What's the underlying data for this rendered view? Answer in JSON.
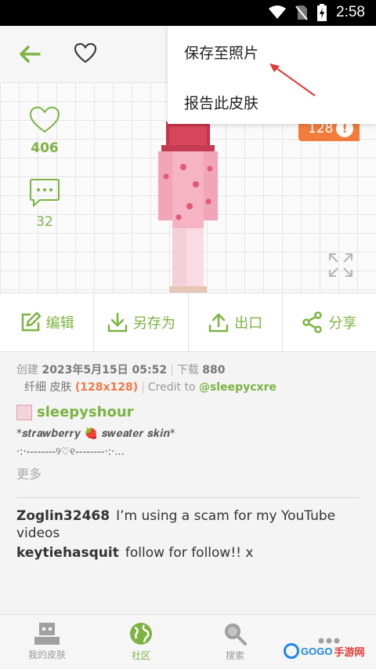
{
  "status_bar": {
    "time": "2:58",
    "icons": [
      "wifi-icon",
      "no-sim-icon",
      "battery-charging-icon"
    ]
  },
  "toolbar": {
    "back": "arrow-left-icon",
    "favorite": "heart-outline-icon"
  },
  "menu": {
    "items": [
      "保存至照片",
      "报告此皮肤"
    ]
  },
  "preview": {
    "likes": "406",
    "comments": "32",
    "resolution_badge": "128",
    "info_symbol": "!"
  },
  "actions": [
    {
      "label": "编辑",
      "icon": "edit-icon"
    },
    {
      "label": "另存为",
      "icon": "download-icon"
    },
    {
      "label": "出口",
      "icon": "upload-icon"
    },
    {
      "label": "分享",
      "icon": "share-icon"
    }
  ],
  "meta": {
    "created_label": "创建",
    "created_value": "2023年5月15日 05:52",
    "downloads_label": "下载",
    "downloads_value": "880",
    "model_label": "纤细",
    "type_label": "皮肤",
    "resolution": "(128x128)",
    "credit_label": "Credit to",
    "credit_user": "@sleepycxre"
  },
  "author": {
    "name": "sleepyshour"
  },
  "description": {
    "line1": "*𝒔𝒕𝒓𝒂𝒘𝒃𝒆𝒓𝒓𝒚 🍓 𝒔𝒘𝒆𝒂𝒕𝒆𝒓 𝒔𝒌𝒊𝒏*",
    "line2": "·:·--------୨♡୧--------·:·...",
    "more": "更多"
  },
  "comments": [
    {
      "user": "Zoglin32468",
      "text": "I’m using a scam for my YouTube videos"
    },
    {
      "user": "keytiehasquit",
      "text": "follow for follow!! x"
    }
  ],
  "bottom_nav": [
    {
      "label": "我的皮肤",
      "icon": "my-skins-icon"
    },
    {
      "label": "社区",
      "icon": "globe-icon"
    },
    {
      "label": "搜索",
      "icon": "search-icon"
    },
    {
      "label": "",
      "icon": "more-icon"
    }
  ],
  "watermark": {
    "part1": "GOGO",
    "part2": "手游网"
  },
  "colors": {
    "accent": "#7cb342",
    "badge": "#f27c3b",
    "creator_name": "#f07a4a"
  }
}
